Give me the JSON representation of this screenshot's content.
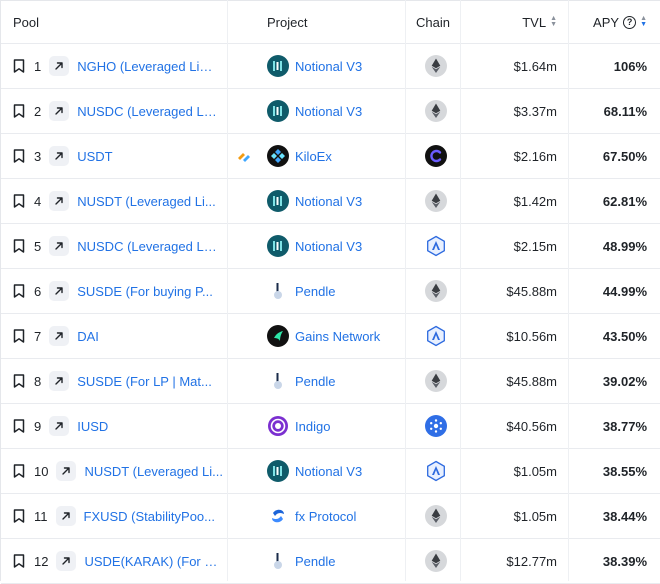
{
  "header": {
    "pool": "Pool",
    "project": "Project",
    "chain": "Chain",
    "tvl": "TVL",
    "apy": "APY",
    "apy_help": "?"
  },
  "colors": {
    "link": "#2172e5",
    "text": "#1f2328",
    "notional": "#0f5b6a",
    "kiloex": "#111111",
    "gains": "#111111",
    "indigo": "#7b2fd0",
    "fx": "#1c64d8",
    "pendle": "#6b7c93",
    "arbitrum": "#2d374b",
    "cardano": "#0033ad"
  },
  "rows": [
    {
      "rank": "1",
      "pool": "NGHO (Leveraged Liq...",
      "project": "Notional V3",
      "project_icon": "notional-icon",
      "chain_icon": "ethereum-icon",
      "tvl": "$1.64m",
      "apy": "106%"
    },
    {
      "rank": "2",
      "pool": "NUSDC (Leveraged Li...",
      "project": "Notional V3",
      "project_icon": "notional-icon",
      "chain_icon": "ethereum-icon",
      "tvl": "$3.37m",
      "apy": "68.11%"
    },
    {
      "rank": "3",
      "pool": "USDT",
      "project": "KiloEx",
      "project_icon": "kiloex-icon",
      "chain_icon": "chain-c-icon",
      "tvl": "$2.16m",
      "apy": "67.50%"
    },
    {
      "rank": "4",
      "pool": "NUSDT (Leveraged Li...",
      "project": "Notional V3",
      "project_icon": "notional-icon",
      "chain_icon": "ethereum-icon",
      "tvl": "$1.42m",
      "apy": "62.81%"
    },
    {
      "rank": "5",
      "pool": "NUSDC (Leveraged Li...",
      "project": "Notional V3",
      "project_icon": "notional-icon",
      "chain_icon": "arbitrum-icon",
      "tvl": "$2.15m",
      "apy": "48.99%"
    },
    {
      "rank": "6",
      "pool": "SUSDE (For buying P...",
      "project": "Pendle",
      "project_icon": "pendle-icon",
      "chain_icon": "ethereum-icon",
      "tvl": "$45.88m",
      "apy": "44.99%"
    },
    {
      "rank": "7",
      "pool": "DAI",
      "project": "Gains Network",
      "project_icon": "gains-icon",
      "chain_icon": "arbitrum-icon",
      "tvl": "$10.56m",
      "apy": "43.50%"
    },
    {
      "rank": "8",
      "pool": "SUSDE (For LP | Mat...",
      "project": "Pendle",
      "project_icon": "pendle-icon",
      "chain_icon": "ethereum-icon",
      "tvl": "$45.88m",
      "apy": "39.02%"
    },
    {
      "rank": "9",
      "pool": "IUSD",
      "project": "Indigo",
      "project_icon": "indigo-icon",
      "chain_icon": "cardano-icon",
      "tvl": "$40.56m",
      "apy": "38.77%"
    },
    {
      "rank": "10",
      "pool": "NUSDT (Leveraged Li...",
      "project": "Notional V3",
      "project_icon": "notional-icon",
      "chain_icon": "arbitrum-icon",
      "tvl": "$1.05m",
      "apy": "38.55%"
    },
    {
      "rank": "11",
      "pool": "FXUSD (StabilityPoo...",
      "project": "fx Protocol",
      "project_icon": "fx-protocol-icon",
      "chain_icon": "ethereum-icon",
      "tvl": "$1.05m",
      "apy": "38.44%"
    },
    {
      "rank": "12",
      "pool": "USDE(KARAK) (For bu...",
      "project": "Pendle",
      "project_icon": "pendle-icon",
      "chain_icon": "ethereum-icon",
      "tvl": "$12.77m",
      "apy": "38.39%"
    }
  ]
}
